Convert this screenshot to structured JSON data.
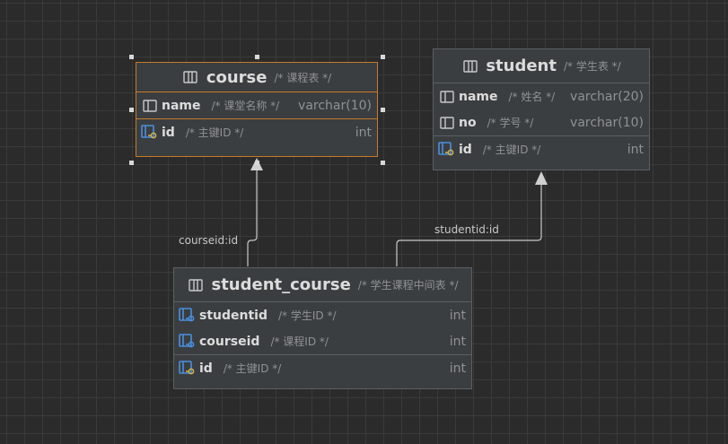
{
  "tables": {
    "course": {
      "name": "course",
      "comment": "/* 课程表 */",
      "columns": [
        {
          "name": "name",
          "comment": "/* 课堂名称 */",
          "type": "varchar(10)"
        }
      ],
      "keys": [
        {
          "name": "id",
          "comment": "/* 主键ID */",
          "type": "int"
        }
      ]
    },
    "student": {
      "name": "student",
      "comment": "/* 学生表 */",
      "columns": [
        {
          "name": "name",
          "comment": "/* 姓名 */",
          "type": "varchar(20)"
        },
        {
          "name": "no",
          "comment": "/* 学号 */",
          "type": "varchar(10)"
        }
      ],
      "keys": [
        {
          "name": "id",
          "comment": "/* 主键ID */",
          "type": "int"
        }
      ]
    },
    "student_course": {
      "name": "student_course",
      "comment": "/* 学生课程中间表 */",
      "columns": [
        {
          "name": "studentid",
          "comment": "/* 学生ID */",
          "type": "int"
        },
        {
          "name": "courseid",
          "comment": "/* 课程ID */",
          "type": "int"
        }
      ],
      "keys": [
        {
          "name": "id",
          "comment": "/* 主键ID */",
          "type": "int"
        }
      ]
    }
  },
  "relations": [
    {
      "label": "courseid:id",
      "from": "student_course",
      "to": "course"
    },
    {
      "label": "studentid:id",
      "from": "student_course",
      "to": "student"
    }
  ],
  "colors": {
    "background": "#2b2b2b",
    "table_bg": "#3b3e40",
    "selected_border": "#c57a2a",
    "key_icon": "#4a8fe0",
    "key_accent": "#d8b34a"
  },
  "icons": {
    "table": "table-icon",
    "column": "column-icon",
    "primary_key": "primary-key-icon",
    "foreign_key": "foreign-key-icon"
  }
}
